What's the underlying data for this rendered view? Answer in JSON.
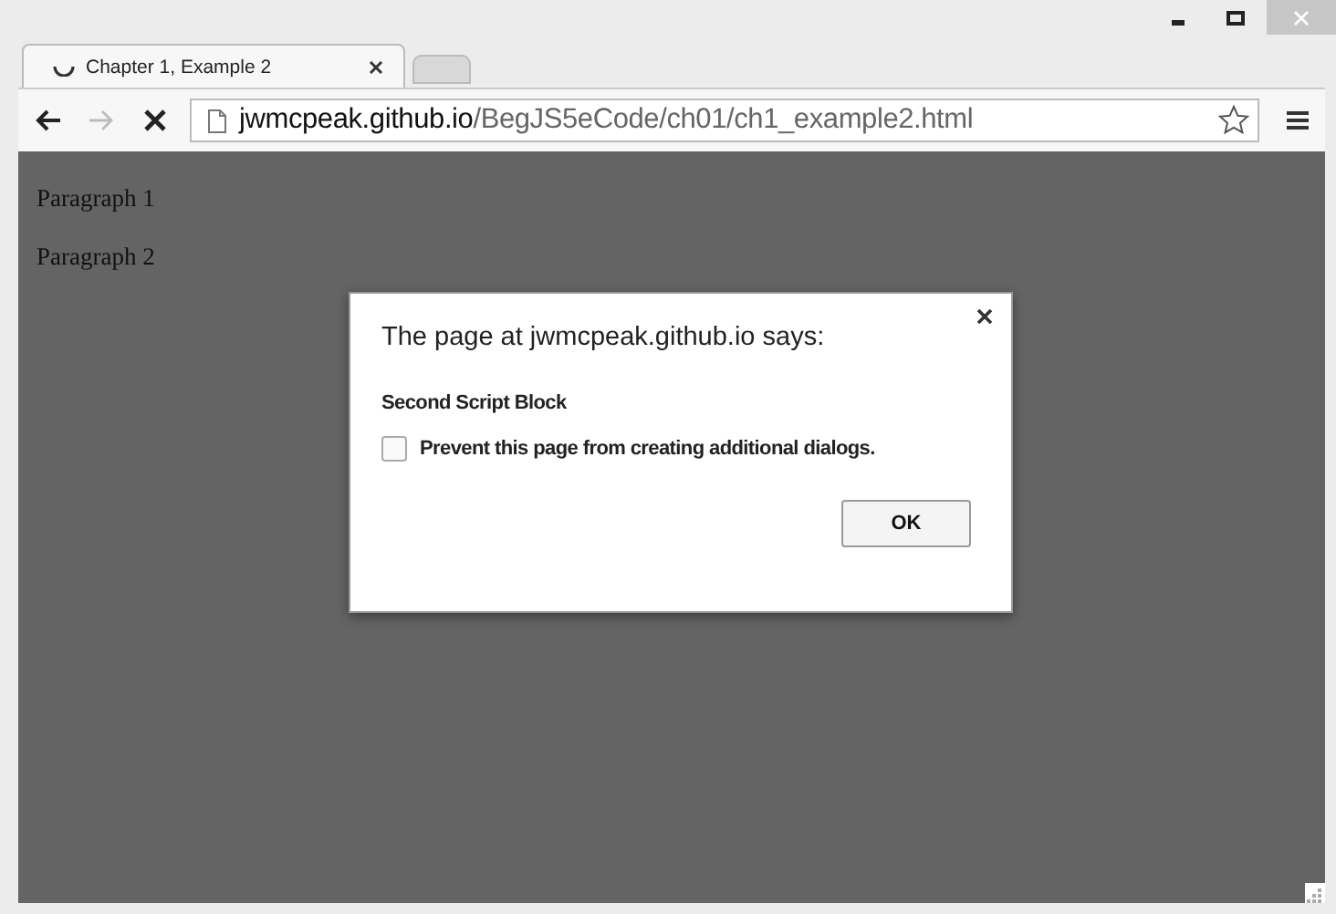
{
  "window": {
    "controls": [
      {
        "kind": "minimize"
      },
      {
        "kind": "maximize"
      },
      {
        "kind": "close"
      }
    ]
  },
  "tabs": [
    {
      "label": "Chapter 1, Example 2",
      "loading": true,
      "selected": true,
      "kind": "page"
    },
    {
      "kind": "new"
    }
  ],
  "toolbar": {
    "back_disabled": false,
    "forward_disabled": true,
    "url_host": "jwmcpeak.github.io",
    "url_path": "/BegJS5eCode/ch01/ch1_example2.html",
    "bookmarked": false
  },
  "page": {
    "paragraphs": [
      "Paragraph 1",
      "Paragraph 2"
    ]
  },
  "dialog": {
    "title": "The page at jwmcpeak.github.io says:",
    "message": "Second Script Block",
    "checkbox": {
      "label": "Prevent this page from creating additional dialogs.",
      "checked": false
    },
    "button": "OK"
  }
}
